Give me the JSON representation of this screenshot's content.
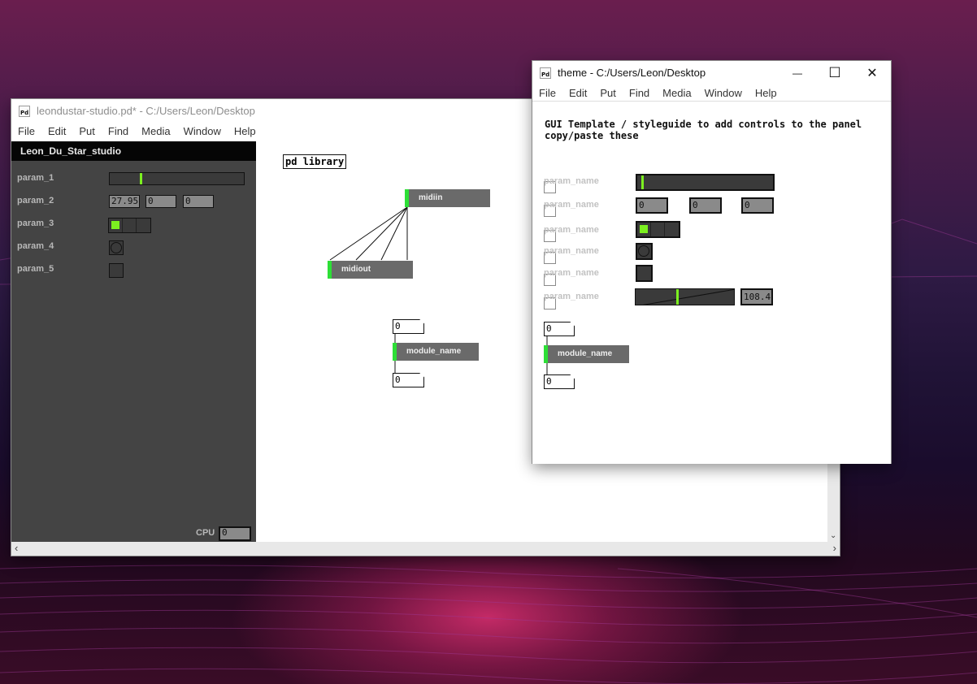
{
  "main_window": {
    "title": "leondustar-studio.pd* - C:/Users/Leon/Desktop",
    "icon_label": "Pd",
    "menu": [
      "File",
      "Edit",
      "Put",
      "Find",
      "Media",
      "Window",
      "Help"
    ],
    "panel": {
      "title": "Leon_Du_Star_studio",
      "params": [
        {
          "label": "param_1",
          "slider_value": 0.23
        },
        {
          "label": "param_2",
          "numbers": [
            "27.95",
            "0",
            "0"
          ]
        },
        {
          "label": "param_3",
          "radio_selected": 0,
          "radio_count": 3
        },
        {
          "label": "param_4"
        },
        {
          "label": "param_5"
        }
      ],
      "cpu_label": "CPU",
      "cpu_value": "0"
    },
    "library_label": "pd library",
    "objects": {
      "midiin": "midiin",
      "midiout": "midiout",
      "module_name": "module_name"
    },
    "msg_top": "0",
    "msg_bottom": "0"
  },
  "theme_window": {
    "title": "theme  - C:/Users/Leon/Desktop",
    "icon_label": "Pd",
    "menu": [
      "File",
      "Edit",
      "Put",
      "Find",
      "Media",
      "Window",
      "Help"
    ],
    "controls": {
      "minimize": "—",
      "maximize": "☐",
      "close": "✕"
    },
    "heading_line1": "GUI Template / styleguide to add controls to the panel",
    "heading_line2": "copy/paste these",
    "param_label": "param_name",
    "numbers": [
      "0",
      "0",
      "0"
    ],
    "slider_value": 0.03,
    "radio_selected": 0,
    "diag_slider_value": 0.42,
    "diag_number": "108.4",
    "msg_top": "0",
    "module_name": "module_name",
    "msg_bottom": "0"
  }
}
